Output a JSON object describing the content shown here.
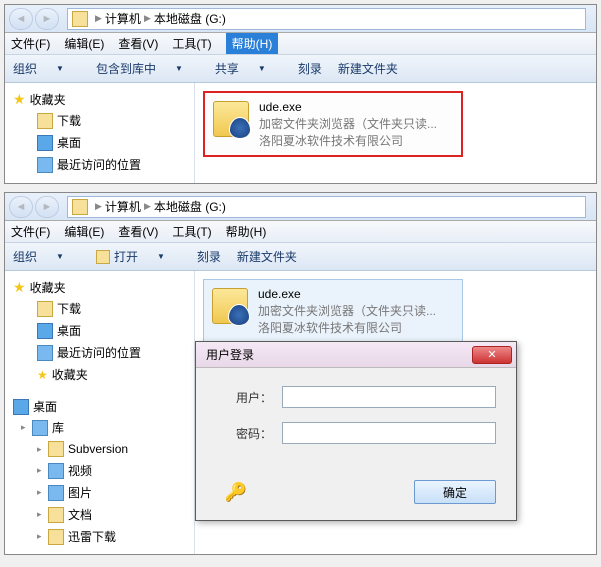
{
  "win1": {
    "breadcrumb": {
      "seg1": "计算机",
      "seg2": "本地磁盘 (G:)"
    },
    "menu": {
      "file": "文件(F)",
      "edit": "编辑(E)",
      "view": "查看(V)",
      "tools": "工具(T)",
      "help": "帮助(H)"
    },
    "toolbar": {
      "org": "组织",
      "include": "包含到库中",
      "share": "共享",
      "burn": "刻录",
      "newfolder": "新建文件夹"
    },
    "sidebar": {
      "fav": "收藏夹",
      "downloads": "下载",
      "desktop": "桌面",
      "recent": "最近访问的位置"
    },
    "file": {
      "name": "ude.exe",
      "desc1": "加密文件夹浏览器（文件夹只读...",
      "desc2": "洛阳夏冰软件技术有限公司"
    }
  },
  "win2": {
    "breadcrumb": {
      "seg1": "计算机",
      "seg2": "本地磁盘 (G:)"
    },
    "menu": {
      "file": "文件(F)",
      "edit": "编辑(E)",
      "view": "查看(V)",
      "tools": "工具(T)",
      "help": "帮助(H)"
    },
    "toolbar": {
      "org": "组织",
      "open": "打开",
      "burn": "刻录",
      "newfolder": "新建文件夹"
    },
    "sidebar": {
      "fav": "收藏夹",
      "downloads": "下载",
      "desktop": "桌面",
      "recent": "最近访问的位置",
      "fav2": "收藏夹",
      "desktop2": "桌面",
      "libs": "库",
      "svn": "Subversion",
      "video": "视频",
      "pictures": "图片",
      "docs": "文档",
      "xunlei": "迅雷下载"
    },
    "file": {
      "name": "ude.exe",
      "desc1": "加密文件夹浏览器（文件夹只读...",
      "desc2": "洛阳夏冰软件技术有限公司"
    },
    "dialog": {
      "title": "用户登录",
      "user": "用户：",
      "pass": "密码：",
      "ok": "确定"
    }
  }
}
